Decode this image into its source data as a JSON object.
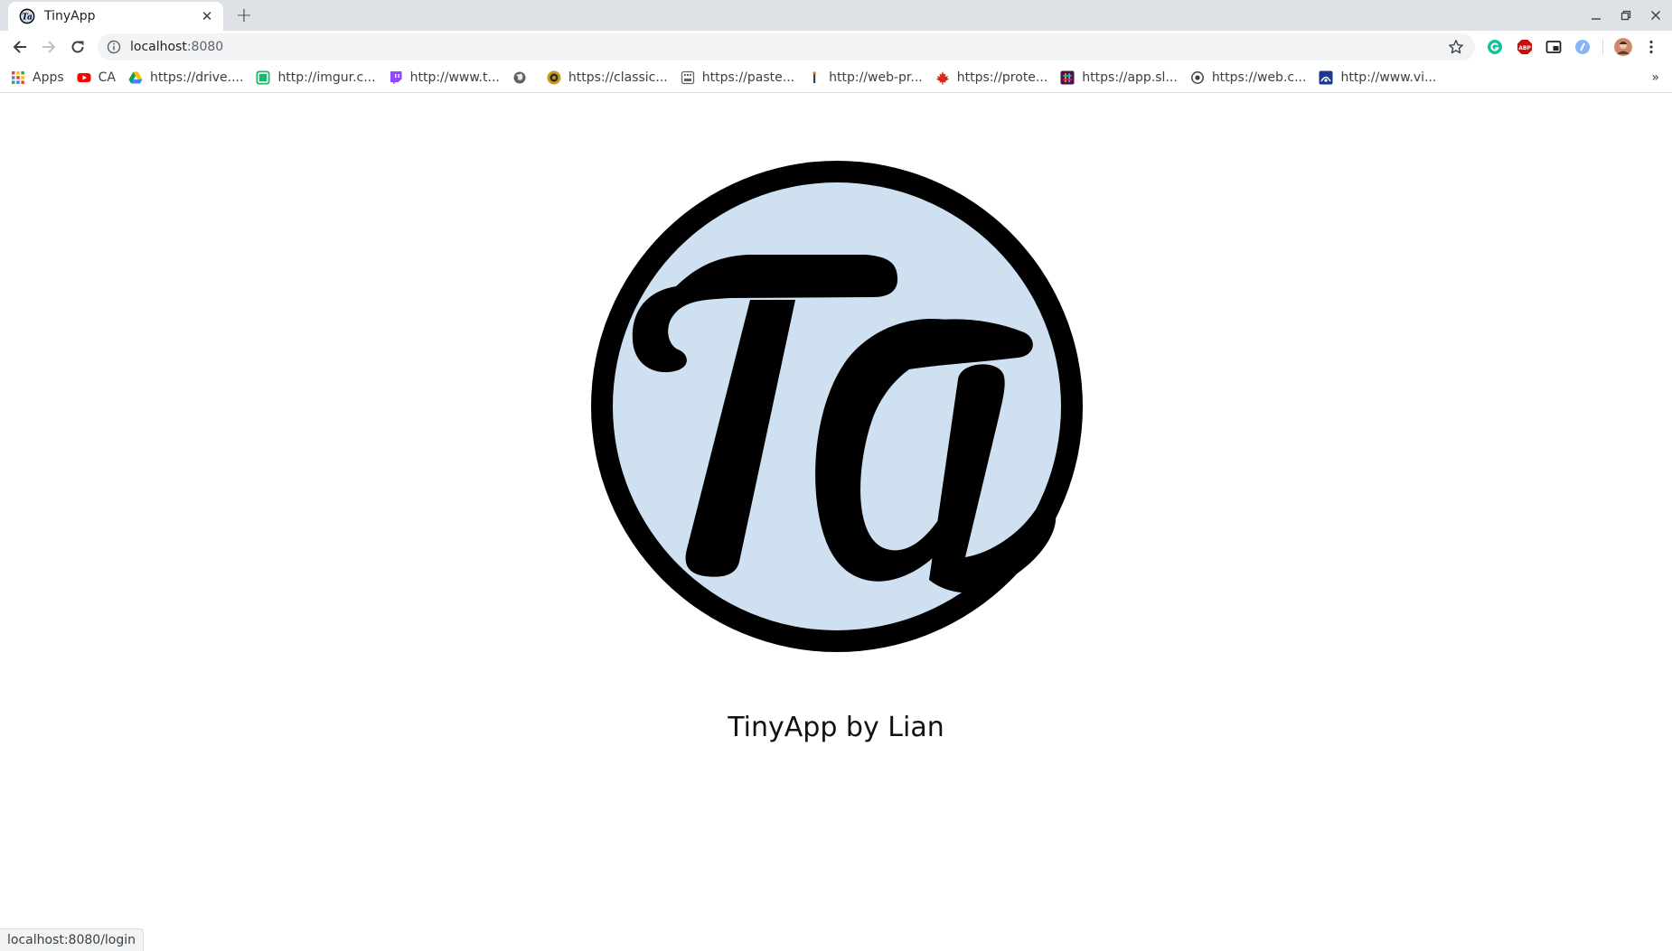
{
  "browser": {
    "tab": {
      "title": "TinyApp",
      "favicon": "tinyapp-logo-icon"
    },
    "omnibox": {
      "host": "localhost",
      "port": ":8080"
    },
    "bookmarks": [
      {
        "label": "Apps",
        "icon": "apps-grid-icon",
        "color": "#4285f4"
      },
      {
        "label": "CA",
        "icon": "youtube-icon",
        "color": "#ff0000"
      },
      {
        "label": "https://drive....",
        "icon": "drive-icon",
        "color": "#0f9d58"
      },
      {
        "label": "http://imgur.c...",
        "icon": "imgur-icon",
        "color": "#1bb76e"
      },
      {
        "label": "http://www.t...",
        "icon": "twitch-icon",
        "color": "#9146ff"
      },
      {
        "label": "",
        "icon": "globe-icon",
        "color": "#5f6368"
      },
      {
        "label": "https://classic...",
        "icon": "classic-icon",
        "color": "#c49a1a"
      },
      {
        "label": "https://paste...",
        "icon": "paste-icon",
        "color": "#5f6368"
      },
      {
        "label": "http://web-pr...",
        "icon": "web-pr-icon",
        "color": "#3c4043"
      },
      {
        "label": "https://prote...",
        "icon": "maple-leaf-icon",
        "color": "#d52b1e"
      },
      {
        "label": "https://app.sl...",
        "icon": "slack-icon",
        "color": "#4a154b"
      },
      {
        "label": "https://web.c...",
        "icon": "web-c-icon",
        "color": "#3c4043"
      },
      {
        "label": "http://www.vi...",
        "icon": "vi-icon",
        "color": "#1a3a8f"
      }
    ],
    "bookmarks_more": "»",
    "status_url": "localhost:8080/login"
  },
  "page": {
    "title": "TinyApp by Lian",
    "logo_text": "Ta",
    "logo_fill": "#cfe0f1"
  }
}
